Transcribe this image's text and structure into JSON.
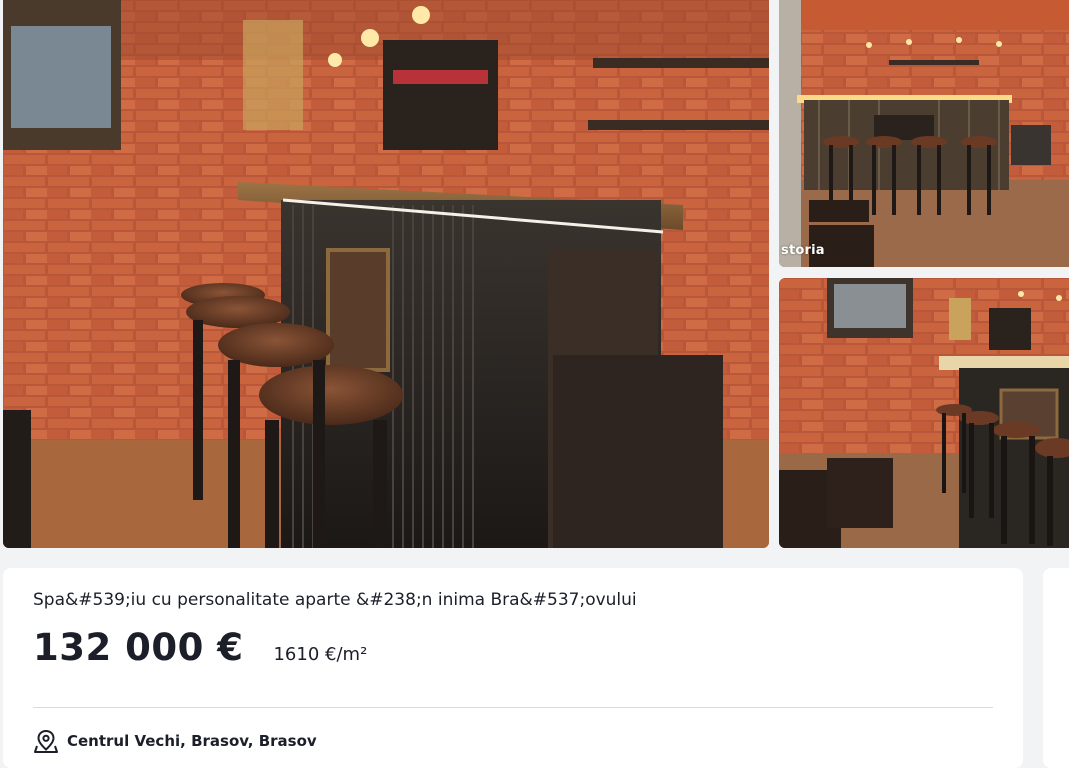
{
  "gallery": {
    "main_photo": "bar-interior-photo",
    "side_photos": [
      "bar-overview-photo",
      "bar-corner-photo"
    ],
    "watermark": "storia"
  },
  "listing": {
    "title": "Spa&#539;iu cu personalitate aparte &#238;n inima Bra&#537;ovului",
    "price": "132 000 €",
    "price_per_sqm": "1610 €/m²",
    "location": "Centrul Vechi, Brasov, Brasov",
    "location_icon": "map-pin-icon"
  },
  "colors": {
    "page_background": "#f2f3f5",
    "card_background": "#ffffff",
    "text": "#1c1f2a",
    "divider": "#d9dbe0"
  }
}
